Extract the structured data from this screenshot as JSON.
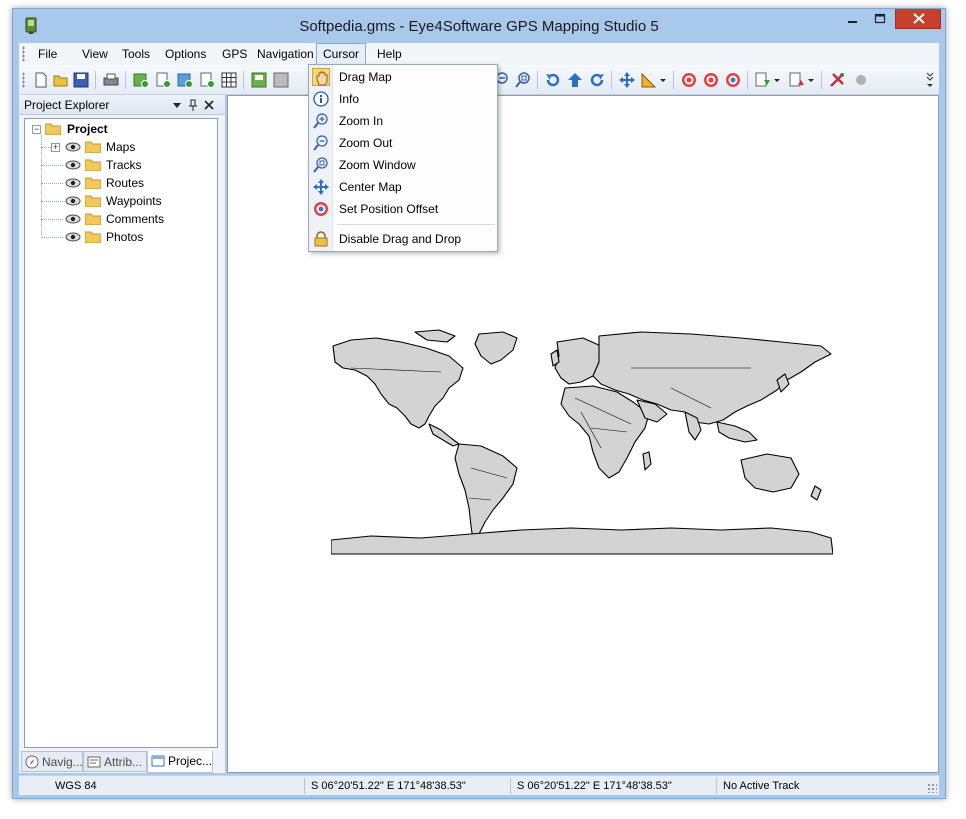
{
  "window": {
    "title": "Softpedia.gms - Eye4Software GPS Mapping Studio 5",
    "accent": "#a8c8ec",
    "close_color": "#c7402e"
  },
  "menubar": {
    "items": [
      "File",
      "View",
      "Tools",
      "Options",
      "GPS",
      "Navigation",
      "Cursor",
      "Help"
    ],
    "open_menu": "Cursor"
  },
  "toolbar": {
    "icons": [
      "new-file-icon",
      "open-folder-icon",
      "save-icon",
      "print-icon",
      "add-map-icon",
      "add-track-icon",
      "add-route-icon",
      "add-waypoint-icon",
      "grid-icon",
      "export-icon",
      "import-icon",
      "zoom-out-icon",
      "zoom-window-icon",
      "undo-icon",
      "up-arrow-icon",
      "redo-icon",
      "center-map-icon",
      "measure-icon",
      "target-icon",
      "target-2-icon",
      "target-3-icon",
      "download-icon",
      "upload-icon",
      "settings-tools-icon",
      "stop-icon"
    ]
  },
  "explorer": {
    "title": "Project Explorer",
    "root": "Project",
    "nodes": [
      "Maps",
      "Tracks",
      "Routes",
      "Waypoints",
      "Comments",
      "Photos"
    ],
    "tabs": [
      {
        "label": "Navig...",
        "icon": "compass-icon"
      },
      {
        "label": "Attrib...",
        "icon": "attributes-icon"
      },
      {
        "label": "Projec...",
        "icon": "project-icon"
      }
    ]
  },
  "cursor_menu": {
    "items": [
      {
        "label": "Drag Map",
        "icon": "hand-icon",
        "highlighted": true
      },
      {
        "label": "Info",
        "icon": "info-icon",
        "highlighted": false
      },
      {
        "label": "Zoom In",
        "icon": "zoom-in-icon",
        "highlighted": false
      },
      {
        "label": "Zoom Out",
        "icon": "zoom-out-icon",
        "highlighted": false
      },
      {
        "label": "Zoom Window",
        "icon": "zoom-window-icon",
        "highlighted": false
      },
      {
        "label": "Center Map",
        "icon": "center-map-icon",
        "highlighted": false
      },
      {
        "label": "Set Position Offset",
        "icon": "position-offset-icon",
        "highlighted": false
      },
      {
        "label": "Disable Drag and Drop",
        "icon": "lock-icon",
        "highlighted": false
      }
    ]
  },
  "map": {
    "land_color": "#d3d3d3",
    "outline_color": "#000000"
  },
  "statusbar": {
    "datum": "WGS 84",
    "position_1": "S 06°20'51.22\" E 171°48'38.53\"",
    "position_2": "S 06°20'51.22\" E 171°48'38.53\"",
    "track": "No Active Track"
  }
}
